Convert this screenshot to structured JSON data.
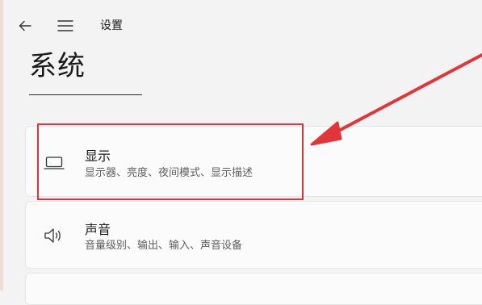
{
  "window": {
    "title": "设置"
  },
  "titlebar": {
    "back_icon": "back-arrow-icon",
    "menu_icon": "hamburger-menu-icon"
  },
  "page": {
    "title": "系统"
  },
  "cards": [
    {
      "title": "显示",
      "subtitle": "显示器、亮度、夜间模式、显示描述",
      "icon": "monitor-icon"
    },
    {
      "title": "声音",
      "subtitle": "音量级别、输出、输入、声音设备",
      "icon": "speaker-icon"
    }
  ],
  "annotation": {
    "color": "#e0363a"
  }
}
